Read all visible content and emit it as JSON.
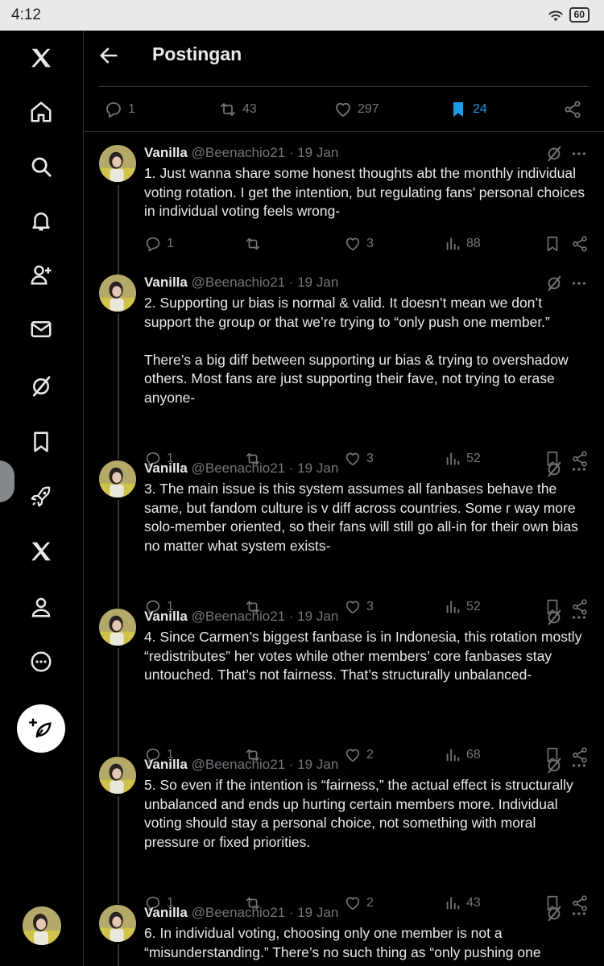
{
  "status_bar": {
    "time": "4:12",
    "battery": "60"
  },
  "nav": {
    "items": [
      "x-logo-icon",
      "home-icon",
      "search-icon",
      "notifications-icon",
      "follow-icon",
      "messages-icon",
      "grok-icon",
      "bookmarks-icon",
      "rocket-icon",
      "premium-x-icon",
      "profile-icon",
      "more-icon"
    ]
  },
  "header": {
    "title": "Postingan"
  },
  "stats": {
    "replies": "1",
    "reposts": "43",
    "likes": "297",
    "bookmarks": "24"
  },
  "colors": {
    "accent": "#1d9bf0",
    "muted": "#71767b",
    "text": "#e7e9ea",
    "background": "#000000"
  },
  "posts": [
    {
      "name": "Vanilla",
      "handle": "@Beenachio21 · 19 Jan",
      "text": "1. Just wanna share some honest thoughts abt the monthly individual voting rotation. I get the intention, but regulating fans’ personal choices in individual voting feels wrong-",
      "replies": "1",
      "likes": "3",
      "views": "88"
    },
    {
      "name": "Vanilla",
      "handle": "@Beenachio21 · 19 Jan",
      "text": "2. Supporting ur bias is normal & valid. It doesn’t mean we don’t support the group or that we’re trying to “only push one member.”\n\nThere’s a big diff between supporting ur bias & trying to overshadow others. Most fans are just supporting their fave, not trying to erase anyone-",
      "replies": "1",
      "likes": "3",
      "views": "52"
    },
    {
      "name": "Vanilla",
      "handle": "@Beenachio21 · 19 Jan",
      "text": "3. The main issue is this system assumes all fanbases behave the same, but fandom culture is v diff across countries. Some r way more solo-member oriented, so their fans will still go all-in for their own bias no matter what system exists-",
      "replies": "1",
      "likes": "3",
      "views": "52"
    },
    {
      "name": "Vanilla",
      "handle": "@Beenachio21 · 19 Jan",
      "text": "4. Since Carmen’s biggest fanbase is in Indonesia, this rotation mostly “redistributes” her votes while other members’ core fanbases stay untouched. That’s not fairness. That’s structurally unbalanced-",
      "replies": "1",
      "likes": "2",
      "views": "68"
    },
    {
      "name": "Vanilla",
      "handle": "@Beenachio21 · 19 Jan",
      "text": "5. So even if the intention is “fairness,” the actual effect is structurally unbalanced and ends up hurting certain members more. Individual voting should stay a personal choice, not something with moral pressure or fixed priorities.",
      "replies": "1",
      "likes": "2",
      "views": "43"
    },
    {
      "name": "Vanilla",
      "handle": "@Beenachio21 · 19 Jan",
      "text": "6. In individual voting, choosing only one member is not a “misunderstanding.” There’s no such thing as “only pushing one",
      "replies": "",
      "likes": "",
      "views": ""
    }
  ]
}
